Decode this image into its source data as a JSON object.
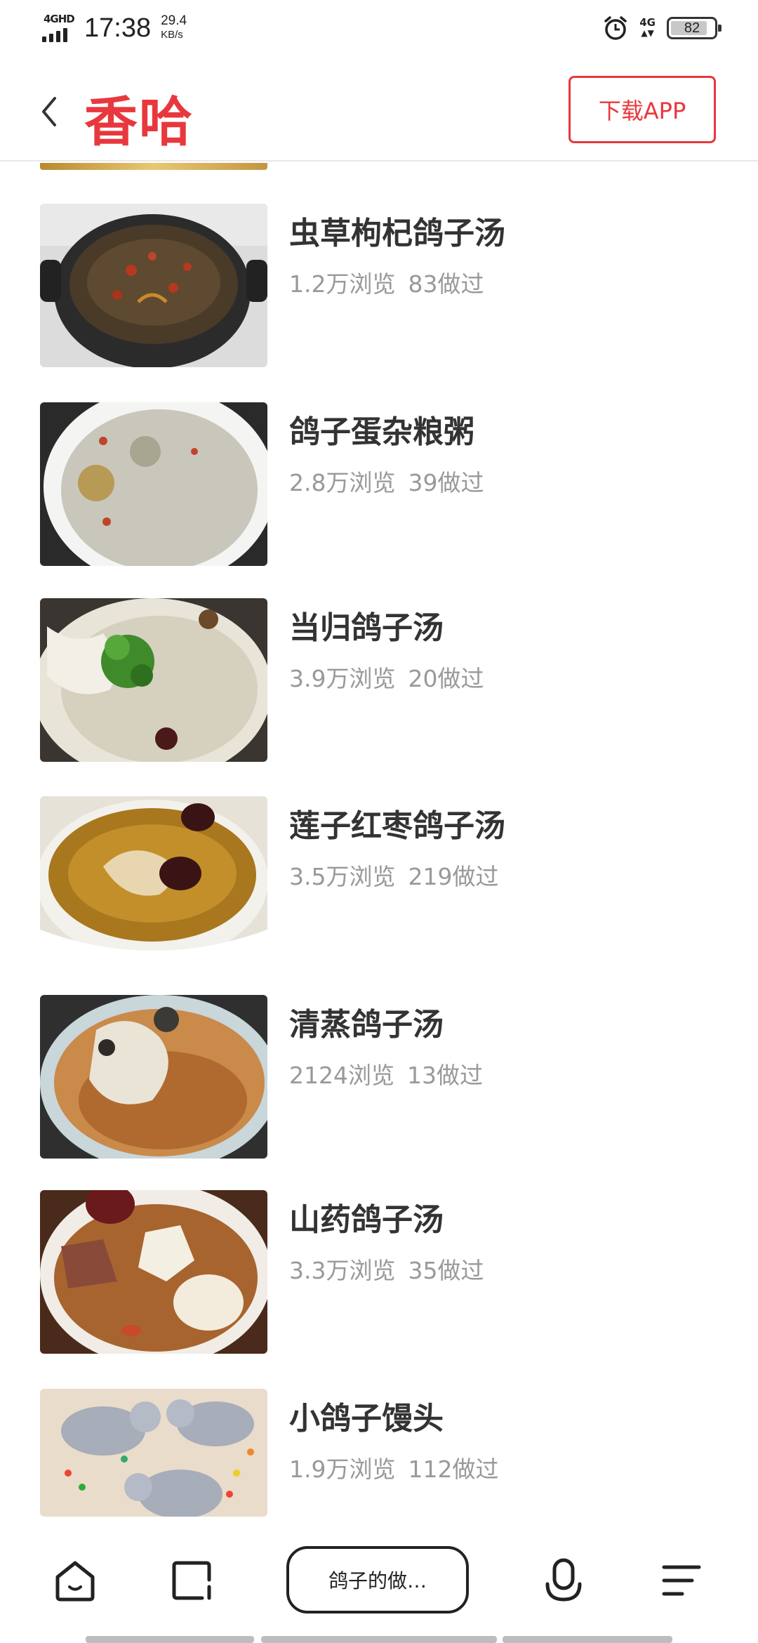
{
  "status_bar": {
    "network": "4GHD",
    "time": "17:38",
    "speed_value": "29.4",
    "speed_unit": "KB/s",
    "mobile_data": "4G",
    "battery": "82"
  },
  "header": {
    "logo": "香哈",
    "download_button": "下载APP",
    "accent_color": "#e8383d"
  },
  "recipes": [
    {
      "title": "虫草枸杞鸽子汤",
      "views": "1.2万浏览",
      "made": "83做过"
    },
    {
      "title": "鸽子蛋杂粮粥",
      "views": "2.8万浏览",
      "made": "39做过"
    },
    {
      "title": "当归鸽子汤",
      "views": "3.9万浏览",
      "made": "20做过"
    },
    {
      "title": "莲子红枣鸽子汤",
      "views": "3.5万浏览",
      "made": "219做过"
    },
    {
      "title": "清蒸鸽子汤",
      "views": "2124浏览",
      "made": "13做过"
    },
    {
      "title": "山药鸽子汤",
      "views": "3.3万浏览",
      "made": "35做过"
    },
    {
      "title": "小鸽子馒头",
      "views": "1.9万浏览",
      "made": "112做过"
    }
  ],
  "bottom_bar": {
    "search_label": "鸽子的做…",
    "icons": [
      "home-icon",
      "tabs-icon",
      "microphone-icon",
      "menu-icon"
    ]
  }
}
